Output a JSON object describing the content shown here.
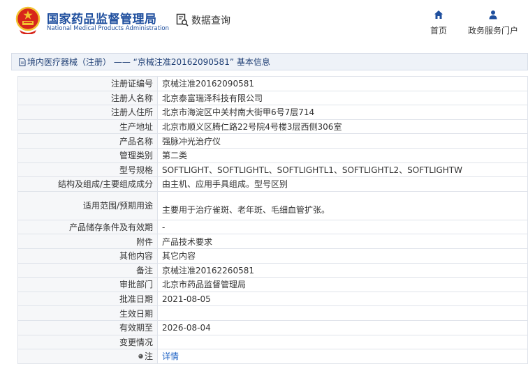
{
  "header": {
    "title_cn": "国家药品监督管理局",
    "title_en": "National Medical Products Administration",
    "query_label": "数据查询",
    "nav_home": "首页",
    "nav_portal": "政务服务门户"
  },
  "breadcrumb": "境内医疗器械（注册） —— “京械注准20162090581” 基本信息",
  "rows": [
    {
      "label": "注册证编号",
      "value": "京械注准20162090581"
    },
    {
      "label": "注册人名称",
      "value": "北京泰富瑞泽科技有限公司"
    },
    {
      "label": "注册人住所",
      "value": "北京市海淀区中关村南大街甲6号7层714"
    },
    {
      "label": "生产地址",
      "value": "北京市顺义区腾仁路22号院4号楼3层西侧306室"
    },
    {
      "label": "产品名称",
      "value": "强脉冲光治疗仪"
    },
    {
      "label": "管理类别",
      "value": "第二类"
    },
    {
      "label": "型号规格",
      "value": "SOFTLIGHT、SOFTLIGHTL、SOFTLIGHTL1、SOFTLIGHTL2、SOFTLIGHTW"
    },
    {
      "label": "结构及组成/主要组成成分",
      "value": "由主机、应用手具组成。型号区别"
    },
    {
      "label": "适用范围/预期用途",
      "value": "主要用于治疗雀斑、老年斑、毛细血管扩张。"
    },
    {
      "label": "产品储存条件及有效期",
      "value": "-"
    },
    {
      "label": "附件",
      "value": "产品技术要求"
    },
    {
      "label": "其他内容",
      "value": "其它内容"
    },
    {
      "label": "备注",
      "value": "京械注准20162260581"
    },
    {
      "label": "审批部门",
      "value": "北京市药品监督管理局"
    },
    {
      "label": "批准日期",
      "value": "2021-08-05"
    },
    {
      "label": "生效日期",
      "value": ""
    },
    {
      "label": "有效期至",
      "value": "2026-08-04"
    },
    {
      "label": "变更情况",
      "value": ""
    }
  ],
  "note": {
    "label": "注",
    "link": "详情"
  },
  "colors": {
    "brand": "#1f4f9e",
    "link": "#1f63c5",
    "emblem_red": "#d7261b",
    "emblem_gold": "#f2c230"
  }
}
